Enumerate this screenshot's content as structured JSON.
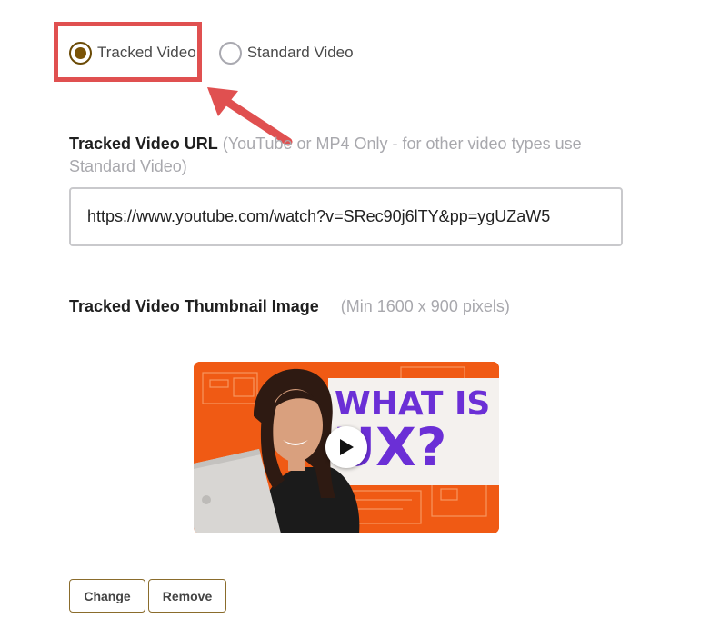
{
  "video_type": {
    "options": [
      {
        "label": "Tracked Video",
        "selected": true
      },
      {
        "label": "Standard Video",
        "selected": false
      }
    ]
  },
  "url_field": {
    "label": "Tracked Video URL",
    "hint": "(YouTube or MP4 Only - for other video types use Standard Video)",
    "value": "https://www.youtube.com/watch?v=SRec90j6lTY&pp=ygUZaW5"
  },
  "thumbnail": {
    "label": "Tracked Video Thumbnail Image",
    "hint": "(Min 1600 x 900 pixels)",
    "overlay_text_line1": "WHAT IS",
    "overlay_text_line2": "UX?",
    "play_icon": "play-icon"
  },
  "actions": {
    "change_label": "Change",
    "remove_label": "Remove"
  },
  "colors": {
    "radio_selected": "#7a5306",
    "highlight": "#e05050",
    "button_border": "#8a6c2c",
    "thumbnail_bg": "#f05a14",
    "thumbnail_text": "#6b2fd6"
  }
}
